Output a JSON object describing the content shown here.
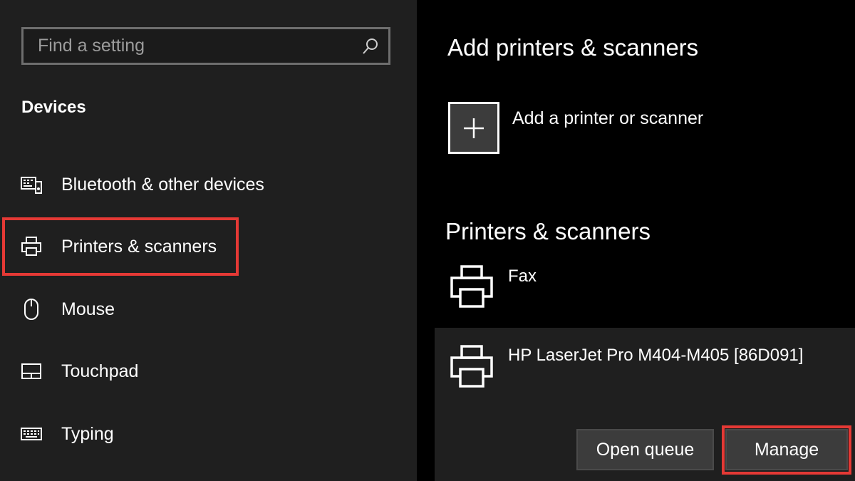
{
  "search": {
    "placeholder": "Find a setting",
    "value": ""
  },
  "sidebar": {
    "heading": "Devices",
    "items": [
      {
        "label": "Bluetooth & other devices",
        "icon": "bluetooth-devices-icon"
      },
      {
        "label": "Printers & scanners",
        "icon": "printer-icon",
        "selected": true
      },
      {
        "label": "Mouse",
        "icon": "mouse-icon"
      },
      {
        "label": "Touchpad",
        "icon": "touchpad-icon"
      },
      {
        "label": "Typing",
        "icon": "keyboard-icon"
      }
    ]
  },
  "main": {
    "add_heading": "Add printers & scanners",
    "add_label": "Add a printer or scanner",
    "list_heading": "Printers & scanners",
    "printers": [
      {
        "name": "Fax",
        "icon": "printer-icon"
      },
      {
        "name": "HP LaserJet Pro M404-M405 [86D091]",
        "icon": "printer-icon",
        "selected": true
      }
    ],
    "buttons": {
      "open_queue": "Open queue",
      "manage": "Manage"
    }
  },
  "colors": {
    "sidebar_bg": "#1f1f1f",
    "main_bg": "#000000",
    "highlight": "#e53935",
    "button_bg": "#3c3c3c"
  }
}
